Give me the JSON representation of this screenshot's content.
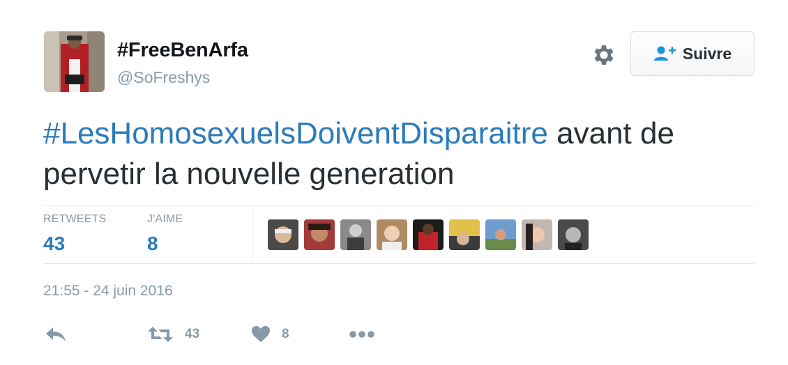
{
  "user": {
    "display_name": "#FreeBenArfa",
    "screen_name": "@SoFreshys",
    "avatar_icon": "user-avatar-photo"
  },
  "follow_button": {
    "label": "Suivre",
    "icon": "add-user-icon"
  },
  "settings_icon": "gear-icon",
  "tweet": {
    "hashtag": "#LesHomosexuelsDoiventDisparaitre",
    "text_line1_rest": " avant de",
    "text_line2": "pervetir la nouvelle generation"
  },
  "stats": {
    "retweets_label": "RETWEETS",
    "retweets_value": "43",
    "likes_label": "J'AIME",
    "likes_value": "8"
  },
  "liked_by": [
    {
      "name": "liker-avatar-1"
    },
    {
      "name": "liker-avatar-2"
    },
    {
      "name": "liker-avatar-3"
    },
    {
      "name": "liker-avatar-4"
    },
    {
      "name": "liker-avatar-5"
    },
    {
      "name": "liker-avatar-6"
    },
    {
      "name": "liker-avatar-7"
    },
    {
      "name": "liker-avatar-8"
    },
    {
      "name": "liker-avatar-9"
    }
  ],
  "timestamp": "21:55 - 24 juin 2016",
  "actions": {
    "reply_icon": "reply-icon",
    "retweet_icon": "retweet-icon",
    "retweet_count": "43",
    "like_icon": "heart-icon",
    "like_count": "8",
    "more_icon": "more-dots-icon"
  },
  "colors": {
    "link": "#2b7bb9",
    "muted": "#8899a6",
    "text": "#292f33",
    "divider": "#e1e8ed"
  }
}
